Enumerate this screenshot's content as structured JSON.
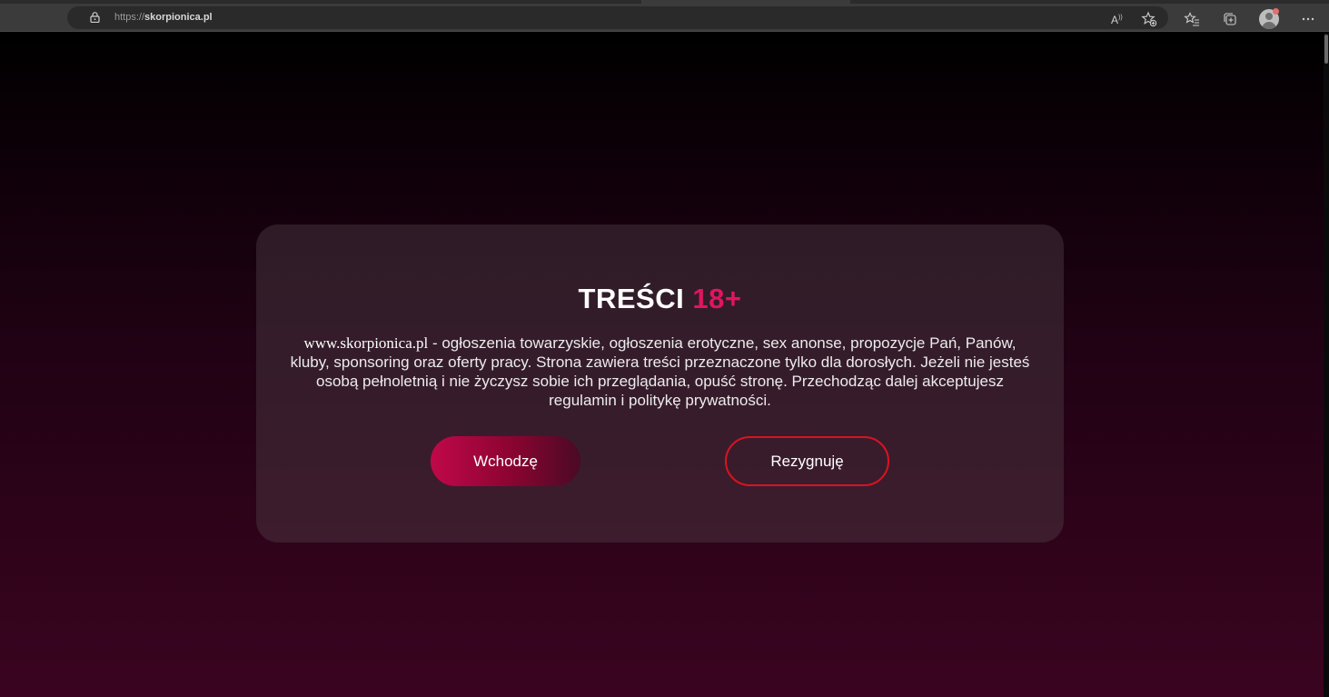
{
  "browser": {
    "url_scheme": "https://",
    "url_host": "skorpionica.pl",
    "icons": [
      "lock-icon",
      "read-aloud-icon",
      "add-favorite-icon",
      "favorites-icon",
      "collections-icon",
      "profile-avatar",
      "more-menu-icon"
    ]
  },
  "modal": {
    "title_main": "TREŚCI",
    "title_accent": "18+",
    "site_name": "www.skorpionica.pl",
    "description": " - ogłoszenia towarzyskie, ogłoszenia erotyczne, sex anonse, propozycje Pań, Panów, kluby, sponsoring oraz oferty pracy. Strona zawiera treści przeznaczone tylko dla dorosłych. Jeżeli nie jesteś osobą pełnoletnią i nie życzysz sobie ich przeglądania, opuść stronę. Przechodząc dalej akceptujesz regulamin i politykę prywatności.",
    "enter_label": "Wchodzę",
    "leave_label": "Rezygnuję"
  },
  "colors": {
    "accent": "#e0155f",
    "enter_button": "#c00849",
    "leave_border": "#d9141f"
  }
}
